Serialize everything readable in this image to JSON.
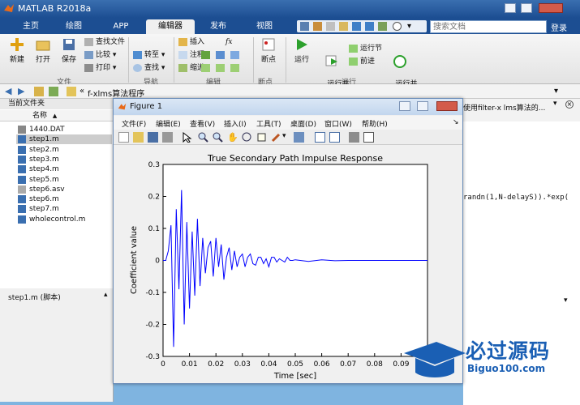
{
  "app": {
    "title": "MATLAB R2018a",
    "tabs": [
      "主页",
      "绘图",
      "APP",
      "编辑器",
      "发布",
      "视图"
    ],
    "search_placeholder": "搜索文档",
    "login": "登录"
  },
  "ribbon": {
    "file": {
      "new": "新建",
      "open": "打开",
      "save": "保存",
      "find_files": "查找文件",
      "compare": "比较",
      "print": "打印",
      "group": "文件"
    },
    "nav": {
      "goto": "转至",
      "find": "查找",
      "group": "导航"
    },
    "edit": {
      "insert": "插入",
      "fx": "fx",
      "comment": "注释",
      "indent": "缩进",
      "group": "编辑"
    },
    "breakpoints": {
      "label": "断点",
      "group": "断点"
    },
    "run": {
      "run": "运行",
      "run_advance": "运行并\n前进",
      "run_section": "运行节",
      "advance": "前进",
      "run_time": "运行并\n计时",
      "group": "运行"
    }
  },
  "address": {
    "path": "f-xlms算法程序",
    "prefix": "«"
  },
  "current_folder": {
    "title": "当前文件夹",
    "col_name": "名称",
    "col_sort": "▲",
    "files": [
      "1440.DAT",
      "step1.m",
      "step2.m",
      "step3.m",
      "step4.m",
      "step5.m",
      "step6.asv",
      "step6.m",
      "step7.m",
      "wholecontrol.m"
    ],
    "selected_index": 1,
    "status": "step1.m  (脚本)"
  },
  "editor_snippets": {
    "text1": "使用filter-x lms算法的...",
    "text2": "randn(1,N-delayS)).*exp("
  },
  "figure": {
    "title": "Figure 1",
    "menu": [
      "文件(F)",
      "编辑(E)",
      "查看(V)",
      "插入(I)",
      "工具(T)",
      "桌面(D)",
      "窗口(W)",
      "帮助(H)"
    ]
  },
  "chart_data": {
    "type": "line",
    "title": "True Secondary Path Impulse Response",
    "xlabel": "Time [sec]",
    "ylabel": "Coefficient value",
    "xlim": [
      0,
      0.1
    ],
    "ylim": [
      -0.3,
      0.3
    ],
    "xticks": [
      0,
      0.01,
      0.02,
      0.03,
      0.04,
      0.05,
      0.06,
      0.07,
      0.08,
      0.09
    ],
    "xtick_labels": [
      "0",
      "0.01",
      "0.02",
      "0.03",
      "0.04",
      "0.05",
      "0.06",
      "0.07",
      "0.08",
      "0.09"
    ],
    "yticks": [
      -0.3,
      -0.2,
      -0.1,
      0,
      0.1,
      0.2,
      0.3
    ],
    "ytick_labels": [
      "-0.3",
      "-0.2",
      "-0.1",
      "0",
      "0.1",
      "0.2",
      "0.3"
    ],
    "grid": false,
    "series": [
      {
        "color": "#0000ff",
        "x": [
          0,
          0.001,
          0.002,
          0.003,
          0.004,
          0.005,
          0.006,
          0.007,
          0.008,
          0.009,
          0.01,
          0.011,
          0.012,
          0.013,
          0.014,
          0.015,
          0.016,
          0.017,
          0.018,
          0.019,
          0.02,
          0.021,
          0.022,
          0.023,
          0.024,
          0.025,
          0.026,
          0.027,
          0.028,
          0.029,
          0.03,
          0.031,
          0.032,
          0.033,
          0.034,
          0.035,
          0.036,
          0.037,
          0.038,
          0.039,
          0.04,
          0.041,
          0.042,
          0.043,
          0.044,
          0.045,
          0.046,
          0.047,
          0.048,
          0.049,
          0.05,
          0.055,
          0.06,
          0.065,
          0.07,
          0.08,
          0.09,
          0.1
        ],
        "y": [
          0,
          0,
          0.03,
          0.11,
          -0.27,
          0.16,
          -0.09,
          0.22,
          -0.2,
          0.12,
          -0.15,
          0.09,
          -0.11,
          0.13,
          -0.08,
          0.07,
          -0.04,
          0.04,
          0.06,
          -0.05,
          0.07,
          -0.02,
          0.05,
          -0.06,
          0.01,
          0.04,
          -0.03,
          0.03,
          -0.02,
          0.01,
          0.02,
          -0.02,
          0.01,
          0.02,
          -0.01,
          -0.015,
          0.01,
          0.01,
          -0.01,
          0.005,
          -0.02,
          0.01,
          0.01,
          -0.005,
          0.005,
          0,
          -0.005,
          0.01,
          0,
          0,
          0.002,
          -0.003,
          0.002,
          -0.001,
          0,
          0,
          0,
          0
        ]
      }
    ]
  },
  "watermark": {
    "big": "必过源码",
    "small": "Biguo100.com"
  }
}
